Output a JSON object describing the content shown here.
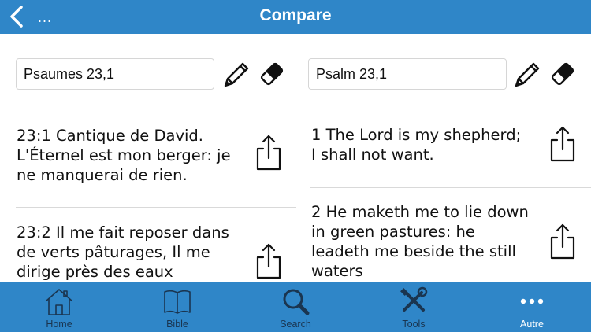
{
  "header": {
    "title": "Compare",
    "back_more": "..."
  },
  "left_panel": {
    "reference": "Psaumes 23,1",
    "verses": [
      "23:1 Cantique de David.\nL'Éternel est mon berger: je\nne manquerai de rien.",
      "23:2 Il me fait reposer dans\nde verts pâturages, Il me\ndirige près des eaux"
    ]
  },
  "right_panel": {
    "reference": "Psalm 23,1",
    "verses": [
      "1 The Lord is my shepherd;\nI shall not want.",
      "2 He maketh me to lie down\nin green pastures: he\nleadeth me beside the still\nwaters"
    ]
  },
  "tabbar": {
    "tabs": [
      {
        "label": "Home",
        "icon": "home-icon"
      },
      {
        "label": "Bible",
        "icon": "book-icon"
      },
      {
        "label": "Search",
        "icon": "search-icon"
      },
      {
        "label": "Tools",
        "icon": "tools-icon"
      },
      {
        "label": "Autre",
        "icon": "more-icon"
      }
    ],
    "active": "Autre"
  },
  "colors": {
    "accent": "#2f86c8",
    "inactive_tab": "#1a3550",
    "divider": "#d9d9d9"
  }
}
